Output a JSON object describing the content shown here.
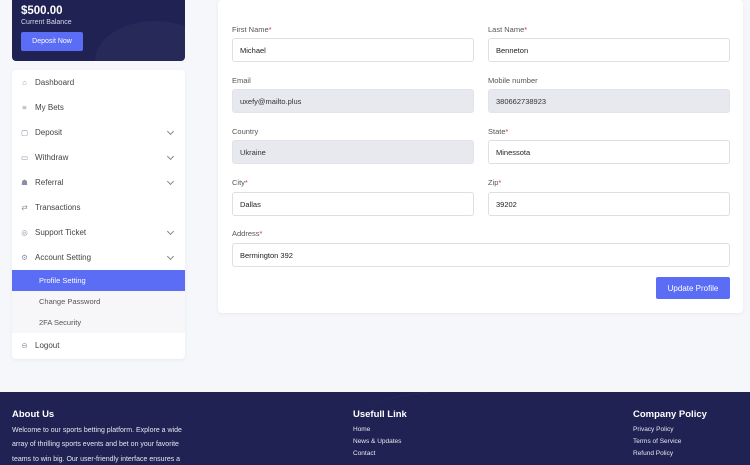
{
  "balance": {
    "amount": "$500.00",
    "caption": "Current Balance",
    "deposit_label": "Deposit Now"
  },
  "sidebar": {
    "items": [
      {
        "label": "Dashboard",
        "icon": "home-icon"
      },
      {
        "label": "My Bets",
        "icon": "list-icon"
      },
      {
        "label": "Deposit",
        "icon": "wallet-icon",
        "expandable": true
      },
      {
        "label": "Withdraw",
        "icon": "cash-icon",
        "expandable": true
      },
      {
        "label": "Referral",
        "icon": "users-icon",
        "expandable": true
      },
      {
        "label": "Transactions",
        "icon": "transfer-icon"
      },
      {
        "label": "Support Ticket",
        "icon": "ticket-icon",
        "expandable": true
      },
      {
        "label": "Account Setting",
        "icon": "settings-icon",
        "expandable": true
      }
    ],
    "sub_items": [
      {
        "label": "Profile Setting",
        "active": true
      },
      {
        "label": "Change Password",
        "active": false
      },
      {
        "label": "2FA Security",
        "active": false
      }
    ],
    "logout": {
      "label": "Logout",
      "icon": "logout-icon"
    }
  },
  "form": {
    "first_name": {
      "label": "First Name",
      "value": "Michael"
    },
    "last_name": {
      "label": "Last Name",
      "value": "Benneton"
    },
    "email": {
      "label": "Email",
      "value": "uxefy@mailto.plus"
    },
    "mobile": {
      "label": "Mobile number",
      "value": "380662738923"
    },
    "country": {
      "label": "Country",
      "value": "Ukraine"
    },
    "state": {
      "label": "State",
      "value": "Minessota"
    },
    "city": {
      "label": "City",
      "value": "Dallas"
    },
    "zip": {
      "label": "Zip",
      "value": "39202"
    },
    "address": {
      "label": "Address",
      "value": "Bermington 392"
    },
    "required_mark": "*",
    "submit_label": "Update Profile"
  },
  "footer": {
    "about": {
      "title": "About Us",
      "lines": [
        "Welcome to our sports betting platform. Explore a wide",
        "array of thrilling sports events and bet on your favorite",
        "teams to win big. Our user-friendly interface ensures a"
      ]
    },
    "links": {
      "title": "Usefull Link",
      "items": [
        "Home",
        "News & Updates",
        "Contact"
      ]
    },
    "policy": {
      "title": "Company Policy",
      "items": [
        "Privacy Policy",
        "Terms of Service",
        "Refund Policy"
      ]
    }
  },
  "colors": {
    "primary": "#5b6cf5",
    "navy": "#1f2252",
    "required": "#e03131",
    "readonly_bg": "#e8e9ee"
  }
}
